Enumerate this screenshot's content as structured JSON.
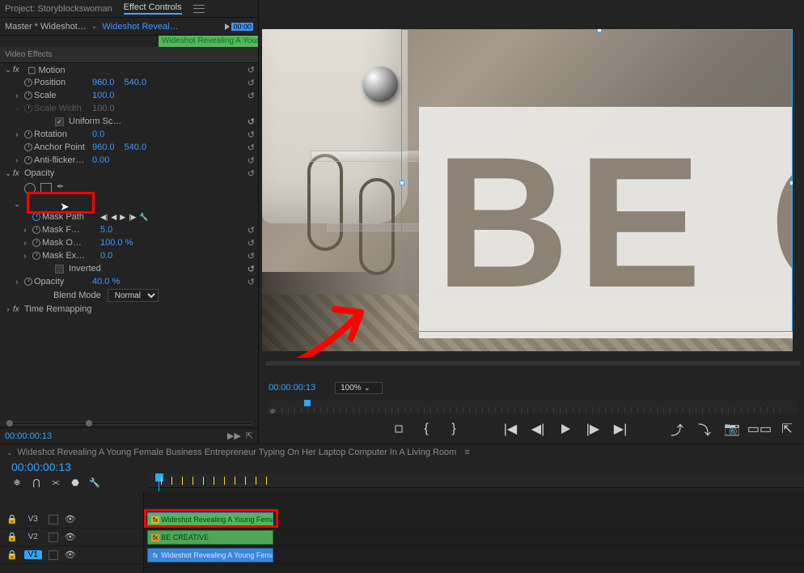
{
  "panel": {
    "project_tab": "Project: Storyblockswoman",
    "effect_tab": "Effect Controls",
    "master_label": "Master * Wideshot…",
    "clip_link": "Wideshot Reveal…",
    "mini_time": "00:00",
    "green_clip_label": "Wideshot Revealing A Young"
  },
  "sections": {
    "video_effects": "Video Effects",
    "motion": "Motion",
    "opacity_group": "Opacity",
    "time_remap": "Time Remapping"
  },
  "motion": {
    "position_label": "Position",
    "position_x": "960.0",
    "position_y": "540.0",
    "scale_label": "Scale",
    "scale_val": "100.0",
    "scalew_label": "Scale Width",
    "scalew_val": "100.0",
    "uniform_label": "Uniform Sc…",
    "rotation_label": "Rotation",
    "rotation_val": "0.0",
    "anchor_label": "Anchor Point",
    "anchor_x": "960.0",
    "anchor_y": "540.0",
    "antiflicker_label": "Anti-flicker…",
    "antiflicker_val": "0.00"
  },
  "mask": {
    "path_label": "Mask Path",
    "maskf_label": "Mask F…",
    "maskf_val": "5.0",
    "masko_label": "Mask O…",
    "masko_val": "100.0 %",
    "maskex_label": "Mask Ex…",
    "maskex_val": "0.0",
    "inverted_label": "Inverted",
    "opacity_label": "Opacity",
    "opacity_val": "40.0 %",
    "blend_label": "Blend Mode",
    "blend_val": "Normal"
  },
  "footer_tc": "00:00:00:13",
  "monitor": {
    "tc": "00:00:00:13",
    "zoom": "100%",
    "big_text": "BE CR"
  },
  "timeline": {
    "sequence_name": "Wideshot Revealing A Young Female Business Entrepreneur Typing On Her Laptop Computer In A Living Room",
    "tc": "00:00:00:13",
    "tracks": {
      "v3": "V3",
      "v2": "V2",
      "v1": "V1"
    },
    "clips": {
      "v3": "Wideshot Revealing A Young Female Bus",
      "v2": "BE CREATIVE",
      "v1": "Wideshot Revealing A Young Female Busi"
    }
  }
}
